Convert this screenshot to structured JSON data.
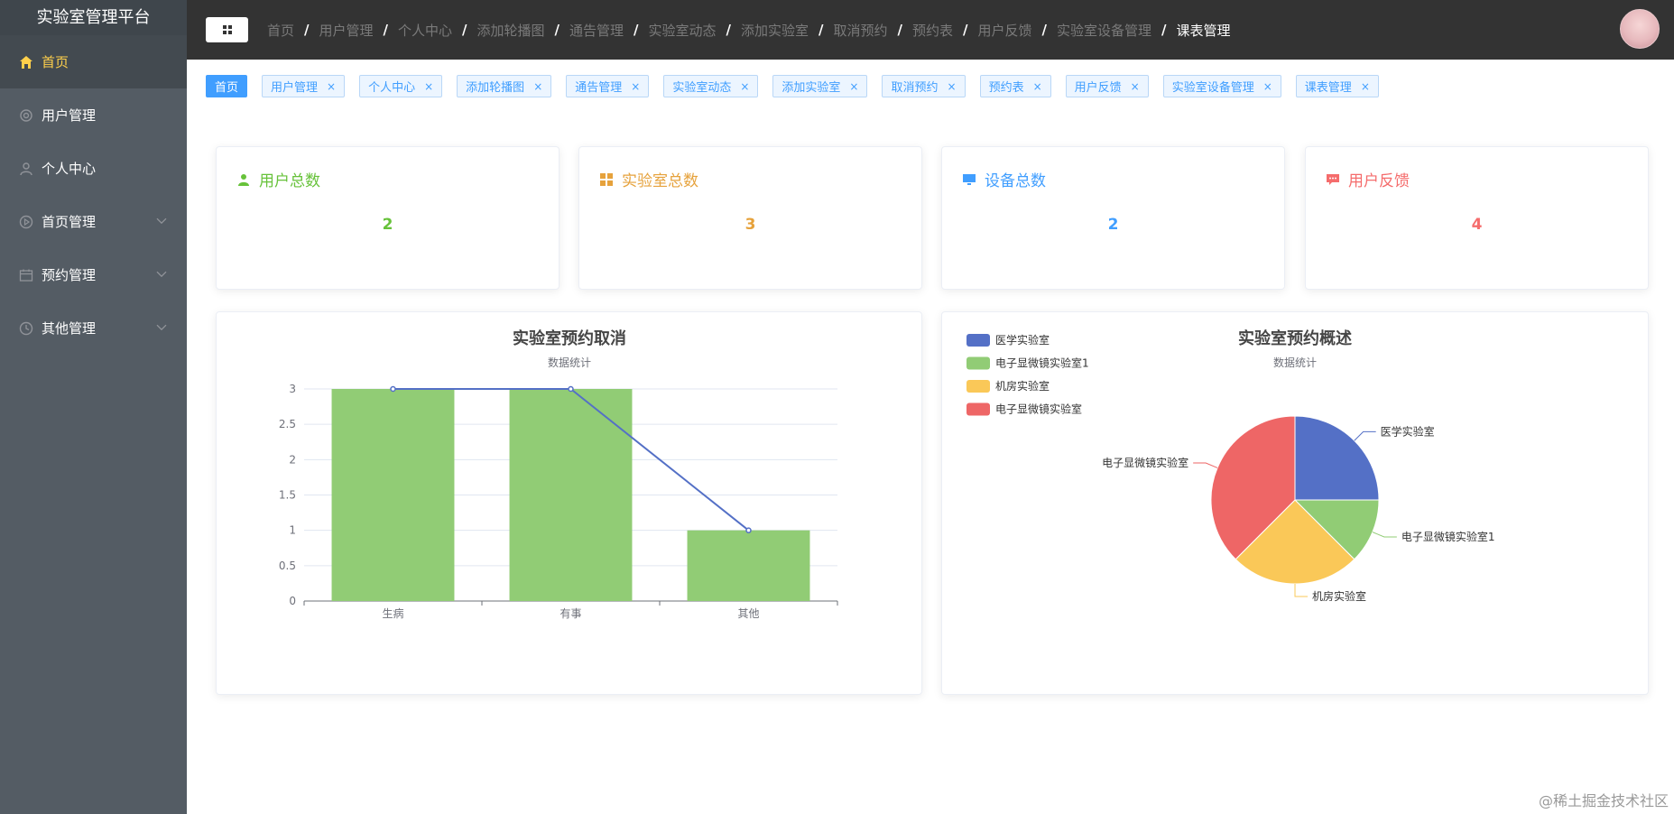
{
  "app": {
    "title": "实验室管理平台"
  },
  "sidebar": {
    "items": [
      {
        "label": "首页",
        "icon": "home-icon",
        "active": true
      },
      {
        "label": "用户管理",
        "icon": "gear-icon"
      },
      {
        "label": "个人中心",
        "icon": "user-icon"
      },
      {
        "label": "首页管理",
        "icon": "play-circle-icon",
        "expandable": true
      },
      {
        "label": "预约管理",
        "icon": "calendar-icon",
        "expandable": true
      },
      {
        "label": "其他管理",
        "icon": "clock-icon",
        "expandable": true
      }
    ]
  },
  "header": {
    "breadcrumb": [
      "首页",
      "用户管理",
      "个人中心",
      "添加轮播图",
      "通告管理",
      "实验室动态",
      "添加实验室",
      "取消预约",
      "预约表",
      "用户反馈",
      "实验室设备管理",
      "课表管理"
    ]
  },
  "tags": [
    {
      "label": "首页",
      "active": true
    },
    {
      "label": "用户管理"
    },
    {
      "label": "个人中心"
    },
    {
      "label": "添加轮播图"
    },
    {
      "label": "通告管理"
    },
    {
      "label": "实验室动态"
    },
    {
      "label": "添加实验室"
    },
    {
      "label": "取消预约"
    },
    {
      "label": "预约表"
    },
    {
      "label": "用户反馈"
    },
    {
      "label": "实验室设备管理"
    },
    {
      "label": "课表管理"
    }
  ],
  "stats": [
    {
      "label": "用户总数",
      "value": "2",
      "color": "#67c23a",
      "icon": "user-solid-icon"
    },
    {
      "label": "实验室总数",
      "value": "3",
      "color": "#e6a23c",
      "icon": "grid-icon"
    },
    {
      "label": "设备总数",
      "value": "2",
      "color": "#409eff",
      "icon": "monitor-icon"
    },
    {
      "label": "用户反馈",
      "value": "4",
      "color": "#f56c6c",
      "icon": "chat-icon"
    }
  ],
  "chart_data": [
    {
      "type": "bar",
      "title": "实验室预约取消",
      "subtitle": "数据统计",
      "categories": [
        "生病",
        "有事",
        "其他"
      ],
      "series": [
        {
          "type": "bar",
          "values": [
            3,
            3,
            1
          ],
          "color": "#91cc75"
        },
        {
          "type": "line",
          "values": [
            3,
            3,
            1
          ],
          "color": "#5470c6"
        }
      ],
      "ylim": [
        0,
        3
      ],
      "yticks": [
        "0",
        "0.5",
        "1",
        "1.5",
        "2",
        "2.5",
        "3"
      ],
      "grid": true
    },
    {
      "type": "pie",
      "title": "实验室预约概述",
      "subtitle": "数据统计",
      "legend_position": "top-left",
      "slices": [
        {
          "name": "医学实验室",
          "value": 1,
          "color": "#5470c6"
        },
        {
          "name": "电子显微镜实验室1",
          "value": 0.5,
          "color": "#91cc75"
        },
        {
          "name": "机房实验室",
          "value": 1,
          "color": "#fac858"
        },
        {
          "name": "电子显微镜实验室",
          "value": 1.5,
          "color": "#ee6666"
        }
      ]
    }
  ],
  "watermark": "@稀土掘金技术社区"
}
